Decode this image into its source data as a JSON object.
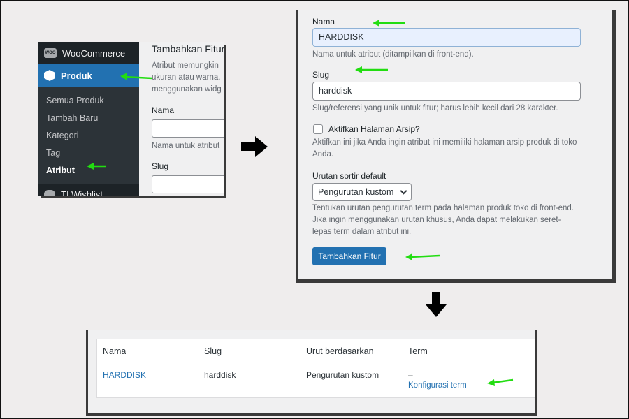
{
  "panel1": {
    "menu": {
      "woocommerce": "WooCommerce",
      "woo_logo_text": "WOO",
      "produk": "Produk",
      "submenu": [
        "Semua Produk",
        "Tambah Baru",
        "Kategori",
        "Tag",
        "Atribut"
      ],
      "wishlist": "TI Wishlist"
    },
    "content": {
      "title": "Tambahkan Fitur",
      "desc_lines": [
        "Atribut memungkin",
        "ukuran atau warna.",
        "menggunakan widg"
      ],
      "label_nama": "Nama",
      "help_nama": "Nama untuk atribut",
      "label_slug": "Slug"
    }
  },
  "panel2": {
    "nama_label": "Nama",
    "nama_value": "HARDDISK",
    "nama_help": "Nama untuk atribut (ditampilkan di front-end).",
    "slug_label": "Slug",
    "slug_value": "harddisk",
    "slug_help": "Slug/referensi yang unik untuk fitur; harus lebih kecil dari 28 karakter.",
    "archive_label": "Aktifkan Halaman Arsip?",
    "archive_help": "Aktifkan ini jika Anda ingin atribut ini memiliki halaman arsip produk di toko Anda.",
    "sort_label": "Urutan sortir default",
    "sort_value": "Pengurutan kustom",
    "sort_help": "Tentukan urutan pengurutan term pada halaman produk toko di front-end. Jika ingin menggunakan urutan khusus, Anda dapat melakukan seret-lepas term dalam atribut ini.",
    "submit_label": "Tambahkan Fitur"
  },
  "panel3": {
    "headers": [
      "Nama",
      "Slug",
      "Urut berdasarkan",
      "Term"
    ],
    "row": {
      "nama": "HARDDISK",
      "slug": "harddisk",
      "urut": "Pengurutan kustom",
      "term_dash": "–",
      "term_link": "Konfigurasi term"
    }
  },
  "colors": {
    "wp_blue": "#2271b1",
    "admin_dark": "#1d2327",
    "annotation_green": "#22dd11"
  }
}
